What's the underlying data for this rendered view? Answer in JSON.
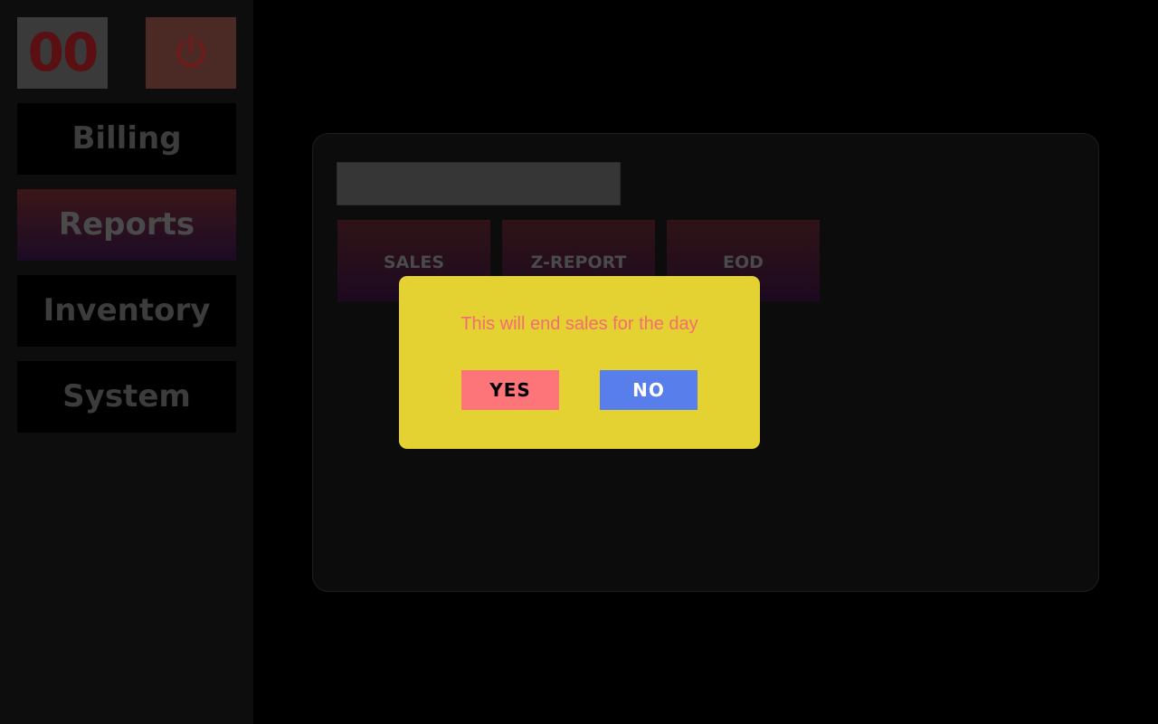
{
  "sidebar": {
    "counter": "00",
    "power_icon": "power-icon",
    "items": [
      {
        "label": "Billing",
        "active": false
      },
      {
        "label": "Reports",
        "active": true
      },
      {
        "label": "Inventory",
        "active": false
      },
      {
        "label": "System",
        "active": false
      }
    ]
  },
  "reports_panel": {
    "search_value": "",
    "buttons": [
      {
        "label": "SALES"
      },
      {
        "label": "Z-REPORT"
      },
      {
        "label": "EOD"
      }
    ]
  },
  "dialog": {
    "message": "This will end sales for the day",
    "yes_label": "YES",
    "no_label": "NO"
  },
  "colors": {
    "dialog_background": "#e4d232",
    "message_text": "#f46d72",
    "yes_button": "#fd7579",
    "no_button": "#587eec",
    "power_tile": "#4b2a26",
    "counter_text": "#5a0f12"
  }
}
